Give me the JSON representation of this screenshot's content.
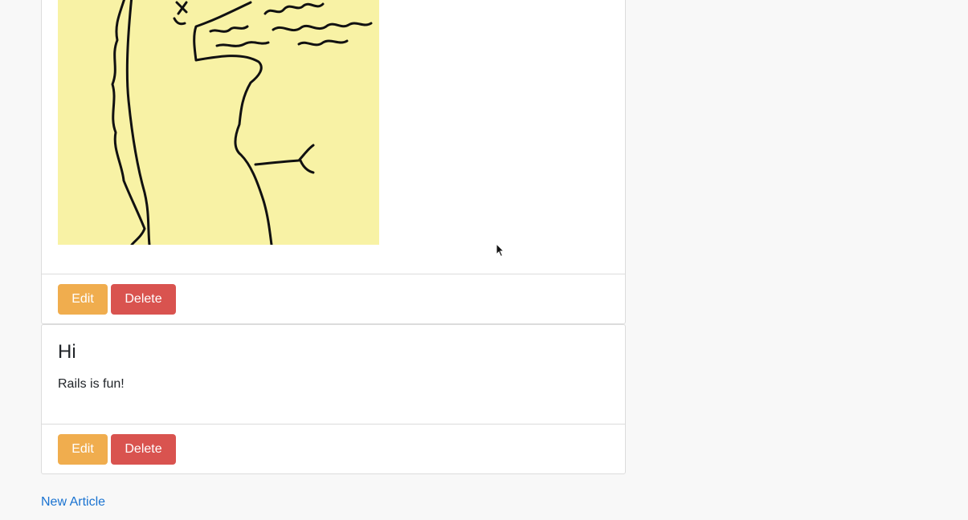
{
  "articles": [
    {
      "title": "",
      "body": "",
      "image_alt": "yellow sticky note drawing",
      "actions": {
        "edit_label": "Edit",
        "delete_label": "Delete"
      }
    },
    {
      "title": "Hi",
      "body": "Rails is fun!",
      "actions": {
        "edit_label": "Edit",
        "delete_label": "Delete"
      }
    }
  ],
  "links": {
    "new_article": "New Article"
  },
  "colors": {
    "edit": "#f0ad4e",
    "delete": "#d9534f",
    "link": "#1a73d1",
    "note": "#f8f2a5"
  }
}
